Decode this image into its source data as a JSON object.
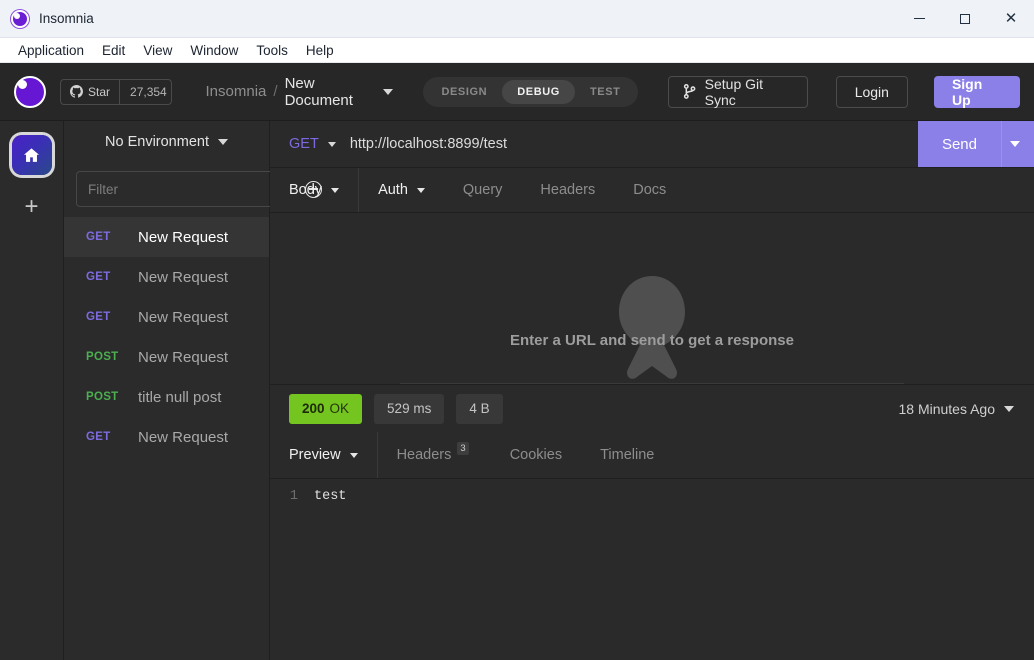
{
  "titlebar": {
    "app_title": "Insomnia",
    "logo_icon": "insomnia-logo-icon",
    "minimize": "—",
    "maximize": "□",
    "close": "✕"
  },
  "menubar": {
    "items": [
      "Application",
      "Edit",
      "View",
      "Window",
      "Tools",
      "Help"
    ]
  },
  "header": {
    "logo_icon": "insomnia-circle-icon",
    "github_icon": "github-icon",
    "star_label": "Star",
    "star_count": "27,354",
    "breadcrumb_app": "Insomnia",
    "breadcrumb_sep": "/",
    "breadcrumb_doc": "New Document",
    "modes": [
      {
        "label": "DESIGN",
        "active": false
      },
      {
        "label": "DEBUG",
        "active": true
      },
      {
        "label": "TEST",
        "active": false
      }
    ],
    "git_sync_label": "Setup Git Sync",
    "git_icon": "git-branch-icon",
    "login_label": "Login",
    "signup_label": "Sign Up",
    "accent_purple": "#8b7fe8"
  },
  "rail": {
    "home_icon": "home-icon",
    "add_icon": "plus-icon",
    "add_label": "+"
  },
  "sidebar": {
    "environment_label": "No Environment",
    "filter_placeholder": "Filter",
    "filter_value": "",
    "sort_icon": "sort-updown-icon",
    "add_icon": "plus-circle-icon",
    "requests": [
      {
        "method": "GET",
        "name": "New Request",
        "active": true
      },
      {
        "method": "GET",
        "name": "New Request",
        "active": false
      },
      {
        "method": "GET",
        "name": "New Request",
        "active": false
      },
      {
        "method": "POST",
        "name": "New Request",
        "active": false
      },
      {
        "method": "POST",
        "name": "title null post",
        "active": false
      },
      {
        "method": "GET",
        "name": "New Request",
        "active": false
      }
    ],
    "method_colors": {
      "GET": "#7e6ae0",
      "POST": "#4caf50"
    }
  },
  "request": {
    "method": "GET",
    "url": "http://localhost:8899/test",
    "send_label": "Send",
    "tabs": [
      {
        "label": "Body",
        "dropdown": true,
        "active": true
      },
      {
        "label": "Auth",
        "dropdown": true,
        "active": true
      },
      {
        "label": "Query",
        "dropdown": false,
        "active": false
      },
      {
        "label": "Headers",
        "dropdown": false,
        "active": false
      },
      {
        "label": "Docs",
        "dropdown": false,
        "active": false
      }
    ],
    "empty_message": "Enter a URL and send to get a response",
    "watermark_icon": "insomnia-watermark-icon"
  },
  "response": {
    "status_code": "200",
    "status_text": "OK",
    "status_color": "#74c520",
    "time": "529 ms",
    "size": "4 B",
    "timestamp": "18 Minutes Ago",
    "tabs": [
      {
        "label": "Preview",
        "dropdown": true,
        "badge": "",
        "active": true
      },
      {
        "label": "Headers",
        "dropdown": false,
        "badge": "3",
        "active": false
      },
      {
        "label": "Cookies",
        "dropdown": false,
        "badge": "",
        "active": false
      },
      {
        "label": "Timeline",
        "dropdown": false,
        "badge": "",
        "active": false
      }
    ],
    "body_lines": [
      {
        "number": "1",
        "text": "test"
      }
    ]
  }
}
